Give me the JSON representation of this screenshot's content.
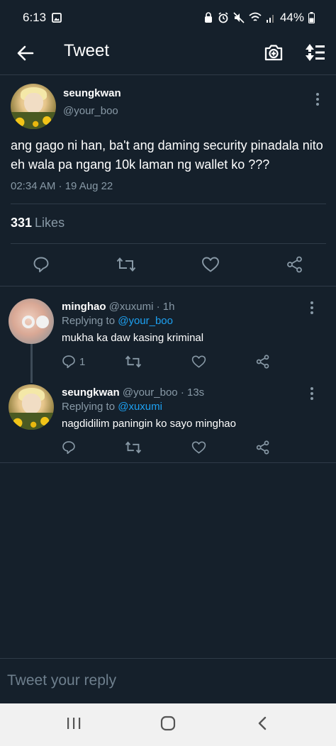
{
  "status_bar": {
    "time": "6:13",
    "battery": "44%"
  },
  "header": {
    "title": "Tweet",
    "back_icon": "arrow-left-icon",
    "camera_icon": "camera-plus-icon",
    "sort_icon": "sort-arrows-icon"
  },
  "main_tweet": {
    "name": "seungkwan",
    "handle": "@your_boo",
    "text": "ang gago ni han, ba't ang daming security pinadala nito eh wala pa ngang 10k laman ng wallet ko ???",
    "timestamp": "02:34 AM · 19 Aug 22",
    "likes_count": "331",
    "likes_label": "Likes"
  },
  "replies": [
    {
      "name": "minghao",
      "handle": "@xuxumi",
      "time": "· 1h",
      "replying_prefix": "Replying to",
      "replying_to": "@your_boo",
      "text": "mukha ka daw kasing kriminal",
      "reply_count": "1"
    },
    {
      "name": "seungkwan",
      "handle": "@your_boo",
      "time": "· 13s",
      "replying_prefix": "Replying to",
      "replying_to": "@xuxumi",
      "text": "nagdidilim paningin ko sayo minghao",
      "reply_count": ""
    }
  ],
  "compose": {
    "placeholder": "Tweet your reply"
  },
  "colors": {
    "background": "#15202b",
    "accent": "#1da1f2",
    "muted": "#8899a6",
    "divider": "#2f3b48"
  }
}
